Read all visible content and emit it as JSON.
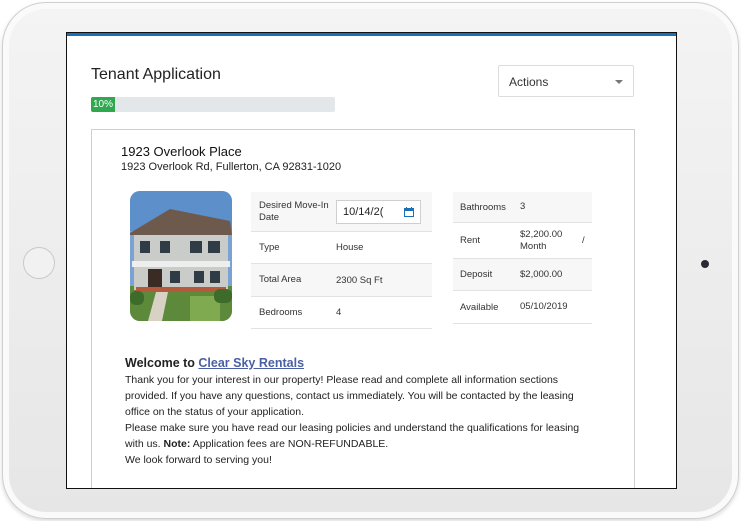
{
  "header": {
    "title": "Tenant Application",
    "progress_label": "10%",
    "progress_value": 10,
    "actions_label": "Actions"
  },
  "property": {
    "name": "1923 Overlook Place",
    "address": "1923 Overlook Rd, Fullerton, CA 92831-1020"
  },
  "details_left": {
    "move_in_label": "Desired Move-In Date",
    "move_in_value": "10/14/2(",
    "type_label": "Type",
    "type_value": "House",
    "area_label": "Total Area",
    "area_value": "2300 Sq Ft",
    "bedrooms_label": "Bedrooms",
    "bedrooms_value": "4"
  },
  "details_right": {
    "bathrooms_label": "Bathrooms",
    "bathrooms_value": "3",
    "rent_label": "Rent",
    "rent_value": "$2,200.00 Month",
    "rent_suffix": "/",
    "deposit_label": "Deposit",
    "deposit_value": "$2,000.00",
    "available_label": "Available",
    "available_value": "05/10/2019"
  },
  "welcome": {
    "prefix": "Welcome to",
    "link": "Clear Sky Rentals",
    "p1": "Thank you for your interest in our property! Please read and complete all information sections provided. If you have any questions, contact us immediately. You will be contacted by the leasing office on the status of your application.",
    "p2_start": "Please make sure you have read our leasing policies and understand the qualifications for leasing with us.",
    "note_label": "Note:",
    "p2_end": "Application fees are NON-REFUNDABLE.",
    "p3": "We look forward to serving you!"
  },
  "colors": {
    "progress": "#2fa84f",
    "link": "#4a5fa5",
    "accent": "#1b6fb5"
  }
}
